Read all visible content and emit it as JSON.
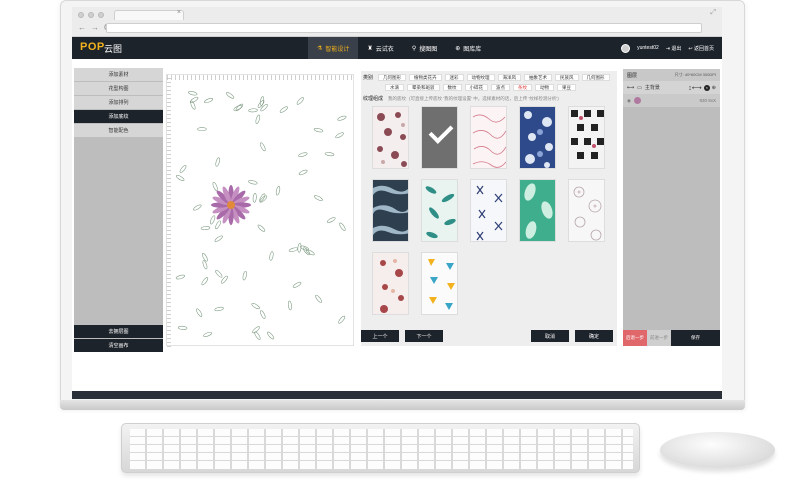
{
  "app": {
    "logo": "POP",
    "logo_cn": "云图"
  },
  "topnav": [
    {
      "label": "智能设计",
      "icon": "design-icon",
      "active": true
    },
    {
      "label": "云试衣",
      "icon": "dress-icon",
      "active": false
    },
    {
      "label": "搜图图",
      "icon": "search-icon",
      "active": false
    },
    {
      "label": "图库库",
      "icon": "gallery-icon",
      "active": false
    }
  ],
  "user": {
    "name": "yuntest02",
    "logout": "退出",
    "back": "返回首页"
  },
  "leftpanel": {
    "items": [
      {
        "label": "添加素材",
        "active": false
      },
      {
        "label": "花型构图",
        "active": false
      },
      {
        "label": "添加排列",
        "active": false
      },
      {
        "label": "添加底纹",
        "active": true
      },
      {
        "label": "智能配色",
        "active": false
      }
    ],
    "bottom": [
      "去拥层图",
      "清空画布"
    ]
  },
  "picker": {
    "category_label": "类别",
    "categories_row1": [
      "几何图形",
      "植物类花卉",
      "迷彩",
      "动物纹理",
      "海洋风",
      "抽象艺术",
      "民族风",
      "几何图形"
    ],
    "categories_row2": [
      "水滴",
      "晕染和斑驳",
      "数纹",
      "小碎花",
      "波点",
      "条纹",
      "动物",
      "果豆"
    ],
    "active_category": "条纹",
    "style_label": "纹理组成",
    "style_hint": "我的底纹",
    "style_desc": "(可直接上传底纹 '我的纹理设置' 中，选择素材的话，后上传 '纹样检测分析')",
    "prev": "上一个",
    "next": "下一个",
    "cancel": "取消",
    "ok": "确定"
  },
  "rightpanel": {
    "title": "图层",
    "size": "尺寸: 40*60CM 300DPI",
    "layer_main": "主背景",
    "layer_thumb_label": "930 8xX"
  },
  "rp_buttons": {
    "undo": "后退一步",
    "redo": "前进一步",
    "save": "保存"
  },
  "colors": {
    "dark": "#1d232b",
    "accent": "#f3b21d",
    "undo_red": "#e0686b"
  }
}
